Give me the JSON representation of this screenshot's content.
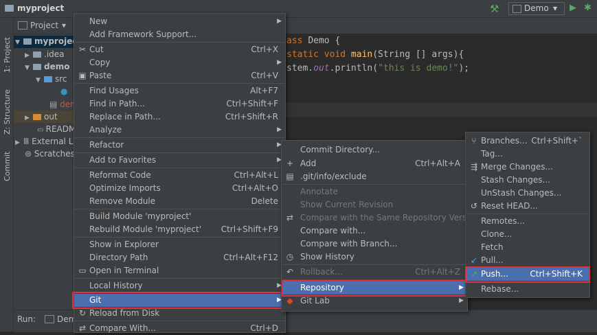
{
  "titlebar": {
    "project": "myproject",
    "run_config": "Demo"
  },
  "left_strip": {
    "project_tab": "1: Project",
    "structure_tab": "Z: Structure",
    "commit_tab": "Commit"
  },
  "project_panel": {
    "header": "Project",
    "items": [
      "myproject",
      ".idea",
      "demo",
      "src",
      "dem",
      "out",
      "READM",
      "External L",
      "Scratches"
    ]
  },
  "editor": {
    "line1_kw": "ass ",
    "line1_rest": "Demo {",
    "line2_kw": "static void ",
    "line2_fn": "main",
    "line2_rest": "(String [] args){",
    "line3_a": "stem.",
    "line3_out": "out",
    "line3_b": ".println(",
    "line3_str": "\"this is demo!\"",
    "line3_c": ");"
  },
  "runbar": {
    "label": "Run:",
    "tab": "Dem"
  },
  "context_menu": {
    "items": [
      {
        "label": "New",
        "shortcut": ""
      },
      {
        "label": "Add Framework Support...",
        "shortcut": ""
      },
      {
        "label": "Cut",
        "shortcut": "Ctrl+X"
      },
      {
        "label": "Copy",
        "shortcut": ""
      },
      {
        "label": "Paste",
        "shortcut": "Ctrl+V"
      },
      {
        "label": "Find Usages",
        "shortcut": "Alt+F7"
      },
      {
        "label": "Find in Path...",
        "shortcut": "Ctrl+Shift+F"
      },
      {
        "label": "Replace in Path...",
        "shortcut": "Ctrl+Shift+R"
      },
      {
        "label": "Analyze",
        "shortcut": ""
      },
      {
        "label": "Refactor",
        "shortcut": ""
      },
      {
        "label": "Add to Favorites",
        "shortcut": ""
      },
      {
        "label": "Reformat Code",
        "shortcut": "Ctrl+Alt+L"
      },
      {
        "label": "Optimize Imports",
        "shortcut": "Ctrl+Alt+O"
      },
      {
        "label": "Remove Module",
        "shortcut": "Delete"
      },
      {
        "label": "Build Module 'myproject'",
        "shortcut": ""
      },
      {
        "label": "Rebuild Module 'myproject'",
        "shortcut": "Ctrl+Shift+F9"
      },
      {
        "label": "Show in Explorer",
        "shortcut": ""
      },
      {
        "label": "Directory Path",
        "shortcut": "Ctrl+Alt+F12"
      },
      {
        "label": "Open in Terminal",
        "shortcut": ""
      },
      {
        "label": "Local History",
        "shortcut": ""
      },
      {
        "label": "Git",
        "shortcut": ""
      },
      {
        "label": "Reload from Disk",
        "shortcut": ""
      },
      {
        "label": "Compare With...",
        "shortcut": "Ctrl+D"
      }
    ]
  },
  "git_menu": {
    "items": [
      {
        "label": "Commit Directory...",
        "shortcut": ""
      },
      {
        "label": "Add",
        "shortcut": "Ctrl+Alt+A"
      },
      {
        "label": ".git/info/exclude",
        "shortcut": ""
      },
      {
        "label": "Annotate",
        "shortcut": ""
      },
      {
        "label": "Show Current Revision",
        "shortcut": ""
      },
      {
        "label": "Compare with the Same Repository Version",
        "shortcut": ""
      },
      {
        "label": "Compare with...",
        "shortcut": ""
      },
      {
        "label": "Compare with Branch...",
        "shortcut": ""
      },
      {
        "label": "Show History",
        "shortcut": ""
      },
      {
        "label": "Rollback...",
        "shortcut": "Ctrl+Alt+Z"
      },
      {
        "label": "Repository",
        "shortcut": ""
      },
      {
        "label": "Git Lab",
        "shortcut": ""
      }
    ]
  },
  "repo_menu": {
    "items": [
      {
        "label": "Branches...",
        "shortcut": "Ctrl+Shift+`"
      },
      {
        "label": "Tag...",
        "shortcut": ""
      },
      {
        "label": "Merge Changes...",
        "shortcut": ""
      },
      {
        "label": "Stash Changes...",
        "shortcut": ""
      },
      {
        "label": "UnStash Changes...",
        "shortcut": ""
      },
      {
        "label": "Reset HEAD...",
        "shortcut": ""
      },
      {
        "label": "Remotes...",
        "shortcut": ""
      },
      {
        "label": "Clone...",
        "shortcut": ""
      },
      {
        "label": "Fetch",
        "shortcut": ""
      },
      {
        "label": "Pull...",
        "shortcut": ""
      },
      {
        "label": "Push...",
        "shortcut": "Ctrl+Shift+K"
      },
      {
        "label": "Rebase...",
        "shortcut": ""
      }
    ]
  },
  "colors": {
    "selection": "#4b6eaf",
    "highlight_box": "#e0303a",
    "menu_bg": "#3c3f41"
  }
}
